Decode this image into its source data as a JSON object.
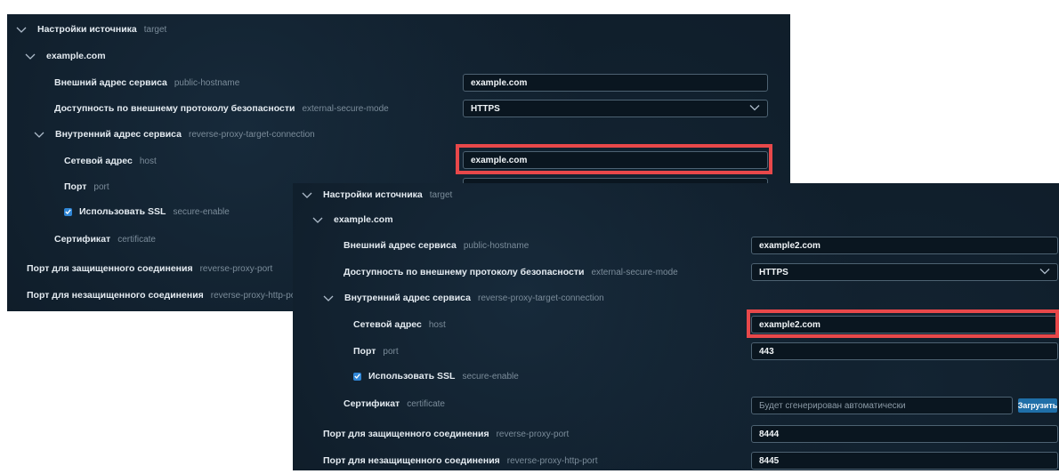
{
  "window1": {
    "section": {
      "label": "Настройки источника",
      "key": "target"
    },
    "source": {
      "label": "example.com"
    },
    "public_hostname": {
      "label": "Внешний адрес сервиса",
      "key": "public-hostname",
      "value": "example.com"
    },
    "external_secure_mode": {
      "label": "Доступность по внешнему протоколу безопасности",
      "key": "external-secure-mode",
      "value": "HTTPS"
    },
    "target_connection": {
      "label": "Внутренний адрес сервиса",
      "key": "reverse-proxy-target-connection"
    },
    "host": {
      "label": "Сетевой адрес",
      "key": "host",
      "value": "example.com"
    },
    "port": {
      "label": "Порт",
      "key": "port"
    },
    "secure_enable": {
      "label": "Использовать SSL",
      "key": "secure-enable"
    },
    "certificate": {
      "label": "Сертификат",
      "key": "certificate"
    },
    "proxy_port": {
      "label": "Порт для защищенного соединения",
      "key": "reverse-proxy-port"
    },
    "proxy_http_port": {
      "label": "Порт для незащищенного соединения",
      "key": "reverse-proxy-http-port"
    }
  },
  "window2": {
    "section": {
      "label": "Настройки источника",
      "key": "target"
    },
    "source": {
      "label": "example.com"
    },
    "public_hostname": {
      "label": "Внешний адрес сервиса",
      "key": "public-hostname",
      "value": "example2.com"
    },
    "external_secure_mode": {
      "label": "Доступность по внешнему протоколу безопасности",
      "key": "external-secure-mode",
      "value": "HTTPS"
    },
    "target_connection": {
      "label": "Внутренний адрес сервиса",
      "key": "reverse-proxy-target-connection"
    },
    "host": {
      "label": "Сетевой адрес",
      "key": "host",
      "value": "example2.com"
    },
    "port": {
      "label": "Порт",
      "key": "port",
      "value": "443"
    },
    "secure_enable": {
      "label": "Использовать SSL",
      "key": "secure-enable"
    },
    "certificate": {
      "label": "Сертификат",
      "key": "certificate",
      "placeholder": "Будет сгенерирован автоматически",
      "upload_label": "Загрузить"
    },
    "proxy_port": {
      "label": "Порт для защищенного соединения",
      "key": "reverse-proxy-port",
      "value": "8444"
    },
    "proxy_http_port": {
      "label": "Порт для незащищенного соединения",
      "key": "reverse-proxy-http-port",
      "value": "8445"
    }
  },
  "colors": {
    "background": "#0e1b27",
    "highlight": "#e8484a",
    "accent": "#2f86d6",
    "text": "#e4ebf1",
    "muted": "#7b8c9a"
  }
}
